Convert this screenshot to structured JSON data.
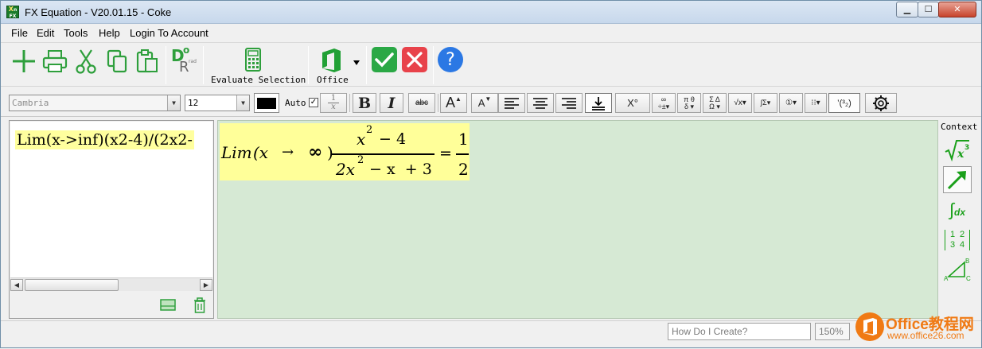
{
  "window": {
    "title": "FX Equation - V20.01.15 - Coke",
    "app_icon_text": "Xⁿ FX",
    "controls": {
      "minimize": "▁",
      "maximize": "☐",
      "close": "✕"
    }
  },
  "menu": {
    "items": [
      "File",
      "Edit",
      "Tools",
      "Help",
      "Login To Account"
    ]
  },
  "toolbar": {
    "new_icon": "plus-icon",
    "print_icon": "printer-icon",
    "cut_icon": "scissors-icon",
    "copy_icon": "copy-icon",
    "paste_icon": "paste-icon",
    "deg_rad_icon": "degree-radian-icon",
    "deg_rad_main": "D",
    "deg_rad_sup": "o",
    "deg_rad_sub": "R",
    "deg_rad_small": "rad",
    "evaluate_label": "Evaluate Selection",
    "office_label": "Office",
    "accept_icon": "check-icon",
    "reject_icon": "x-icon",
    "help_icon": "question-icon",
    "help_glyph": "?",
    "accent_green": "#2aa845",
    "accent_red": "#e8424a",
    "accent_blue": "#2b78e4"
  },
  "format": {
    "font_name": "Cambria",
    "font_size": "12",
    "auto_label": "Auto",
    "fraction_top": "1",
    "fraction_bottom": "x",
    "bold": "B",
    "italic": "I",
    "strike": "abc",
    "grow_font": "A",
    "shrink_font": "A",
    "degree": "X°",
    "paren_sample": "'(3\n2)"
  },
  "input": {
    "text": "Lim(x->inf)(x2-4)/(2x2-"
  },
  "output": {
    "lim": "Lim",
    "lim_var": "(x",
    "arrow": "→",
    "infinity": "∞",
    "close_paren": ")",
    "num_x": "x",
    "num_exp": "2",
    "num_rest": "− 4",
    "den_coef": "2x",
    "den_exp": "2",
    "den_rest": "− x  + 3",
    "equals": "=",
    "res_num": "1",
    "res_den": "2"
  },
  "context": {
    "label": "Context",
    "items": [
      "sqrt-x-cubed-icon",
      "arrow-icon",
      "integral-dx-icon",
      "matrix-icon",
      "triangle-icon"
    ],
    "integral_text": "dx",
    "matrix_values": [
      "1",
      "2",
      "3",
      "4"
    ],
    "triangle_labels": [
      "A",
      "B",
      "C"
    ]
  },
  "status": {
    "help_placeholder": "How Do I Create?",
    "zoom": "150%"
  },
  "watermark": {
    "line1": "Office教程网",
    "line2": "www.office26.com"
  }
}
